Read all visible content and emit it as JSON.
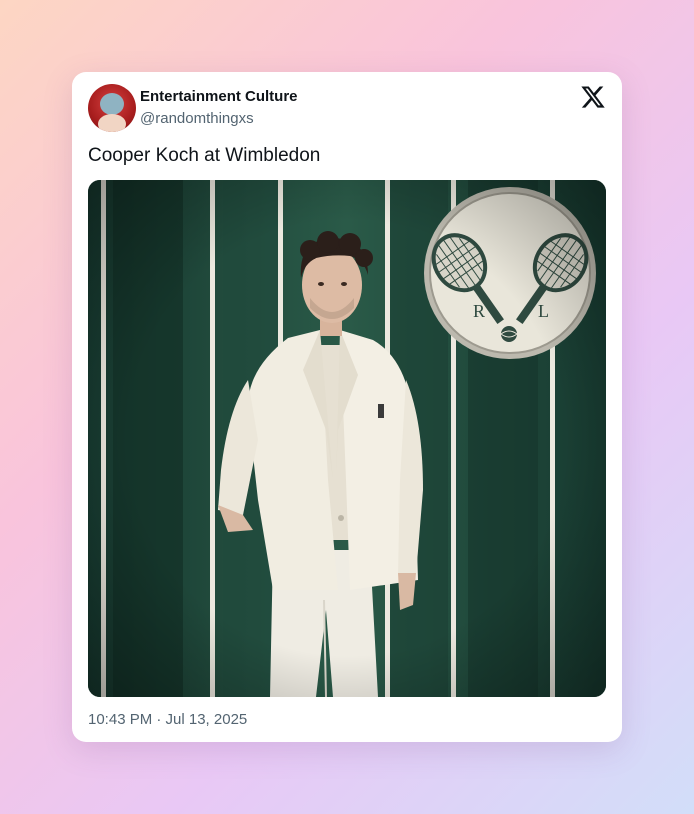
{
  "tweet": {
    "author_name": "Entertainment Culture",
    "author_handle": "@randomthingxs",
    "text": "Cooper Koch at Wimbledon",
    "timestamp": "10:43 PM · Jul 13, 2025"
  },
  "media": {
    "sign_letters": [
      "R",
      "L"
    ]
  },
  "icons": {
    "platform_logo": "x-logo-icon"
  }
}
